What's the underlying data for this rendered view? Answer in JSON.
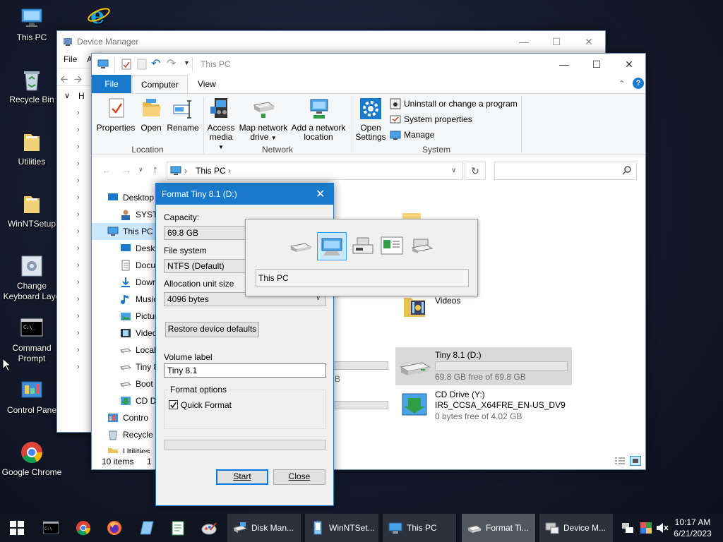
{
  "desktop": {
    "icons": [
      {
        "label": "This PC",
        "icon": "this-pc-icon"
      },
      {
        "label": "Recycle Bin",
        "icon": "recycle-bin-icon"
      },
      {
        "label": "Utilities",
        "icon": "folder-icon"
      },
      {
        "label": "WinNTSetup",
        "icon": "folder-icon"
      },
      {
        "label": "Change Keyboard Layo",
        "icon": "keyboard-settings-icon"
      },
      {
        "label": "Command Prompt",
        "icon": "command-prompt-icon"
      },
      {
        "label": "Control Pane",
        "icon": "control-panel-icon"
      },
      {
        "label": "Google Chrome",
        "icon": "chrome-icon"
      }
    ]
  },
  "device_manager": {
    "title": "Device Manager",
    "menu": [
      "File",
      "A"
    ],
    "tree_root_letter": "H"
  },
  "explorer": {
    "title": "This PC",
    "tabs": [
      "File",
      "Computer",
      "View"
    ],
    "active_tab": "Computer",
    "ribbon": {
      "location": {
        "label": "Location",
        "buttons": [
          "Properties",
          "Open",
          "Rename"
        ]
      },
      "network": {
        "label": "Network",
        "buttons": [
          "Access media",
          "Map network drive",
          "Add a network location"
        ]
      },
      "system": {
        "label": "System",
        "open_settings": "Open Settings",
        "items": [
          "Uninstall or change a program",
          "System properties",
          "Manage"
        ]
      }
    },
    "address": {
      "path": "This PC",
      "search_placeholder": ""
    },
    "nav": [
      {
        "label": "Desktop",
        "indent": 0
      },
      {
        "label": "SYSTEM",
        "indent": 1
      },
      {
        "label": "This PC",
        "indent": 0,
        "selected": true
      },
      {
        "label": "Deskt",
        "indent": 1
      },
      {
        "label": "Docu",
        "indent": 1
      },
      {
        "label": "Down",
        "indent": 1
      },
      {
        "label": "Music",
        "indent": 1
      },
      {
        "label": "Pictur",
        "indent": 1
      },
      {
        "label": "Video",
        "indent": 1
      },
      {
        "label": "Local",
        "indent": 1
      },
      {
        "label": "Tiny 8",
        "indent": 1
      },
      {
        "label": "Boot",
        "indent": 1
      },
      {
        "label": "CD Dr",
        "indent": 1
      },
      {
        "label": "Contro",
        "indent": 0
      },
      {
        "label": "Recycle",
        "indent": 0
      },
      {
        "label": "Utilities",
        "indent": 0
      }
    ],
    "folders": [
      {
        "label": "Videos"
      }
    ],
    "drives": [
      {
        "name": "Tiny 8.1 (D:)",
        "free": "69.8 GB free of 69.8 GB",
        "used_fraction": 0.0
      },
      {
        "name": "CD Drive (Y:)",
        "line2": "IR5_CCSA_X64FRE_EN-US_DV9",
        "free": "0 bytes free of 4.02 GB"
      }
    ],
    "partial_text": [
      "MB",
      "B"
    ],
    "status": {
      "items": "10 items",
      "selected": "1 "
    }
  },
  "format_dialog": {
    "title": "Format Tiny 8.1 (D:)",
    "capacity_label": "Capacity:",
    "capacity_value": "69.8 GB",
    "filesystem_label": "File system",
    "filesystem_value": "NTFS (Default)",
    "alloc_label": "Allocation unit size",
    "alloc_value": "4096 bytes",
    "restore_button": "Restore device defaults",
    "volume_label_label": "Volume label",
    "volume_label_value": "Tiny 8.1",
    "format_options_label": "Format options",
    "quick_format_label": "Quick Format",
    "quick_format_checked": true,
    "progress_fraction": 0.0,
    "start_button": "Start",
    "close_button": "Close"
  },
  "drag_popup": {
    "location_text": "This PC"
  },
  "taskbar": {
    "apps": [
      {
        "label": "Disk Man...",
        "icon": "disk-management-icon"
      },
      {
        "label": "WinNTSet...",
        "icon": "winntsetup-icon"
      },
      {
        "label": "This PC",
        "icon": "this-pc-icon"
      },
      {
        "label": "Format Ti...",
        "icon": "drive-icon",
        "active": true
      },
      {
        "label": "Device M...",
        "icon": "device-manager-icon"
      }
    ],
    "time": "10:17 AM",
    "date": "6/21/2023"
  },
  "colors": {
    "accent": "#0078d7",
    "selection": "#cce8ff",
    "ribbon_file_tab": "#1979ca"
  }
}
